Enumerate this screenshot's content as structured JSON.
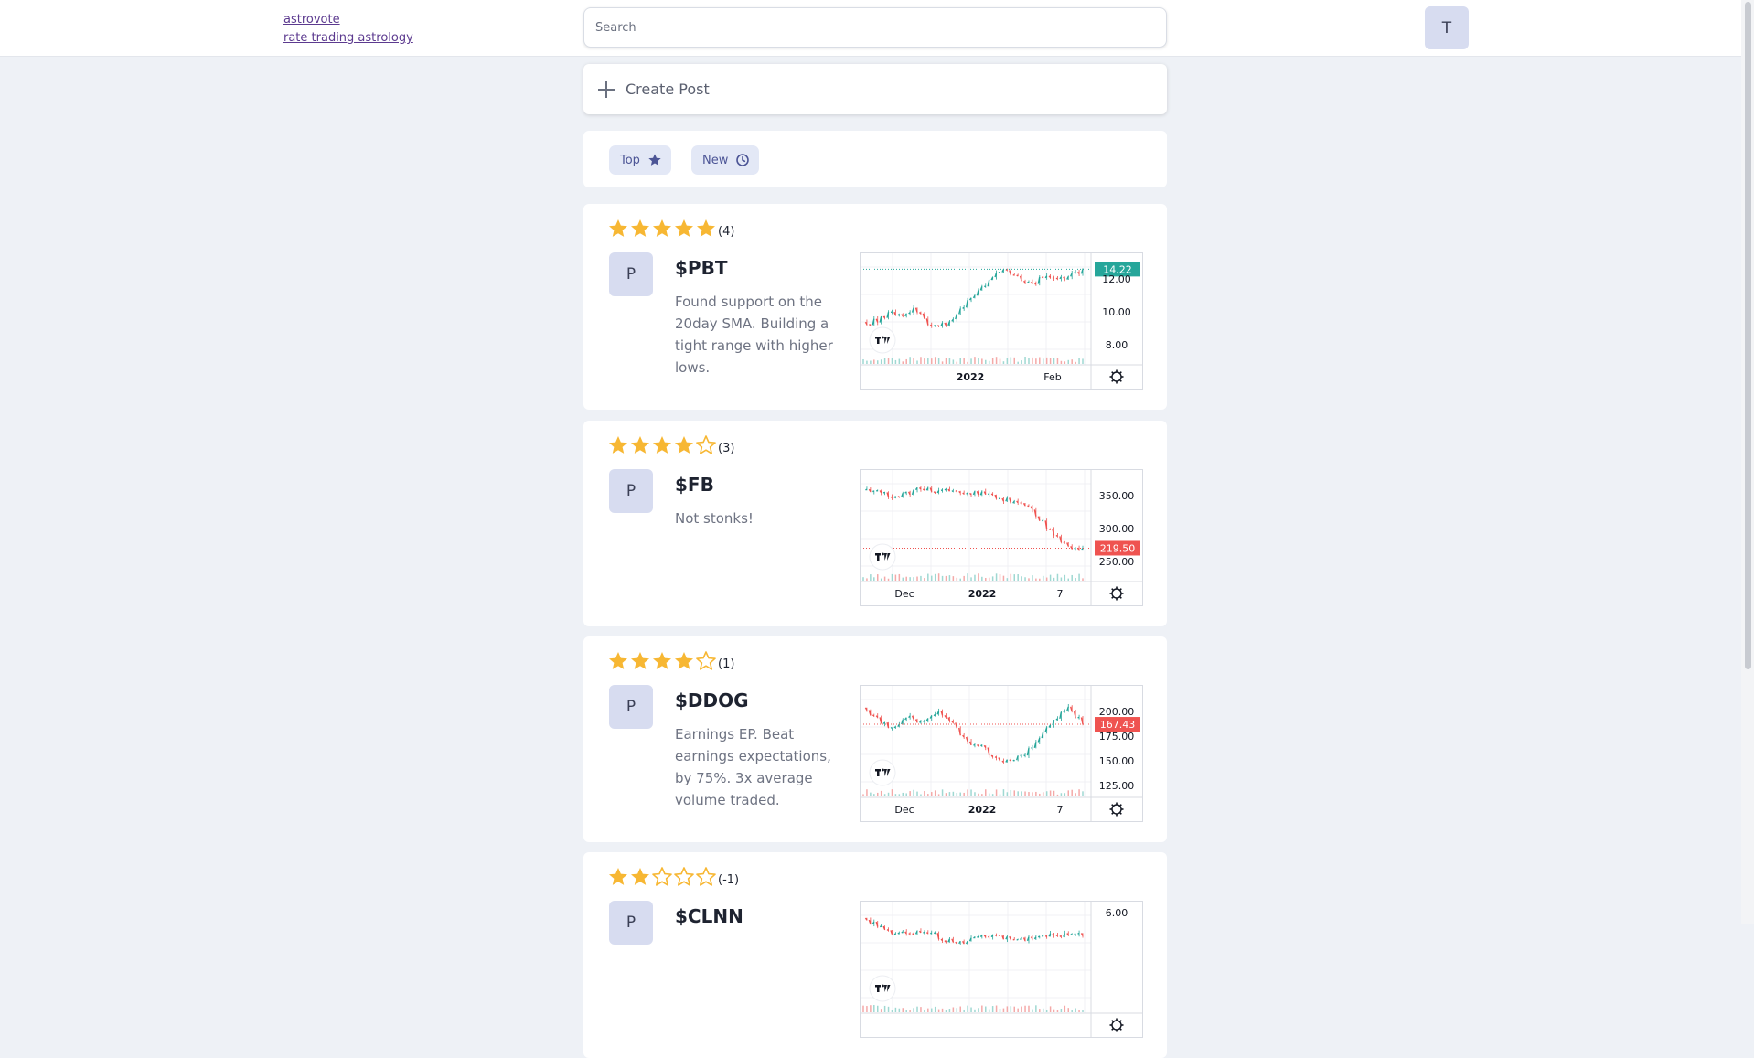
{
  "header": {
    "brand_name": "astrovote",
    "brand_tagline": "rate trading astrology",
    "search_placeholder": "Search",
    "user_initial": "T"
  },
  "create_post": {
    "label": "Create Post"
  },
  "filters": [
    {
      "label": "Top",
      "icon": "star-icon"
    },
    {
      "label": "New",
      "icon": "clock-icon"
    }
  ],
  "colors": {
    "star": "#f7b733",
    "up": "#26a69a",
    "down": "#ef5350",
    "accent": "#4c5596"
  },
  "posts": [
    {
      "rating_stars": 5,
      "rating_count": "(4)",
      "author_initial": "P",
      "ticker": "$PBT",
      "text": "Found support on the 20day SMA. Building a tight range with higher lows.",
      "chart": {
        "price_labels": [
          "12.00",
          "10.00",
          "8.00"
        ],
        "last_price": "14.22",
        "last_price_color": "#26a69a",
        "time_labels": [
          "2022",
          "Feb"
        ]
      }
    },
    {
      "rating_stars": 4,
      "rating_count": "(3)",
      "author_initial": "P",
      "ticker": "$FB",
      "text": "Not stonks!",
      "chart": {
        "price_labels": [
          "350.00",
          "300.00",
          "250.00"
        ],
        "last_price": "219.50",
        "last_price_color": "#ef5350",
        "time_labels": [
          "Dec",
          "2022",
          "7"
        ]
      }
    },
    {
      "rating_stars": 4,
      "rating_count": "(1)",
      "author_initial": "P",
      "ticker": "$DDOG",
      "text": "Earnings EP. Beat earnings expectations, by 75%. 3x average volume traded.",
      "chart": {
        "price_labels": [
          "200.00",
          "175.00",
          "150.00",
          "125.00"
        ],
        "last_price": "167.43",
        "last_price_color": "#ef5350",
        "time_labels": [
          "Dec",
          "2022",
          "7"
        ]
      }
    },
    {
      "rating_stars": 2,
      "rating_count": "(-1)",
      "author_initial": "P",
      "ticker": "$CLNN",
      "text": "",
      "chart": {
        "price_labels": [
          "6.00"
        ],
        "last_price": "",
        "last_price_color": "#26a69a",
        "time_labels": []
      }
    }
  ]
}
